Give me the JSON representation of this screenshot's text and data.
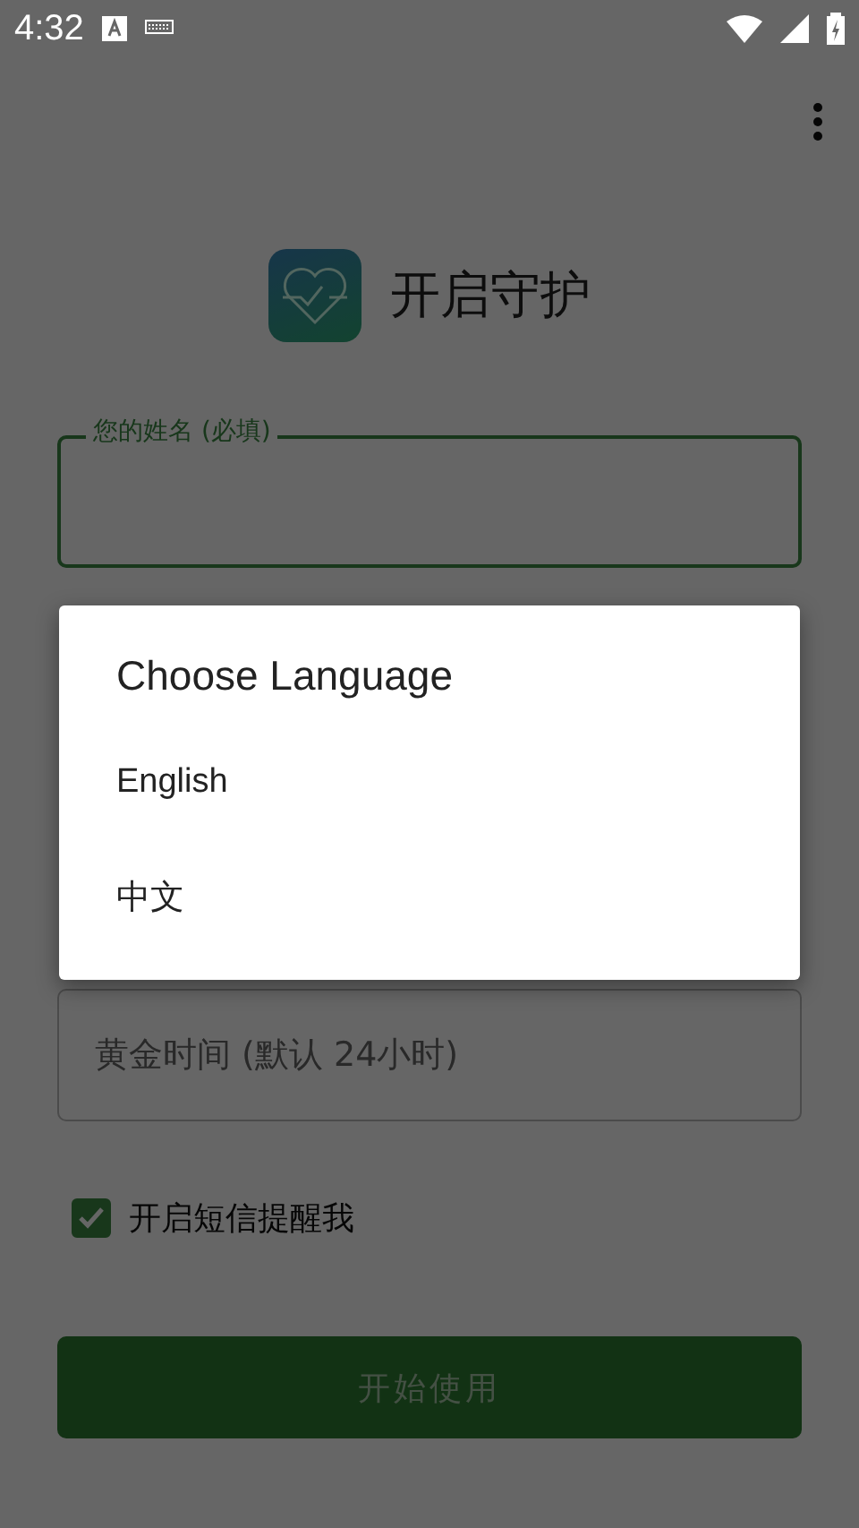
{
  "status_bar": {
    "time": "4:32"
  },
  "header": {
    "title": "开启守护"
  },
  "form": {
    "name_field": {
      "label": "您的姓名 (必填)",
      "focused": true
    },
    "golden_time_field": {
      "placeholder": "黄金时间 (默认 24小时)"
    },
    "sms_checkbox": {
      "label": "开启短信提醒我",
      "checked": true
    },
    "start_button": {
      "label": "开始使用"
    }
  },
  "dialog": {
    "title": "Choose Language",
    "options": [
      {
        "label": "English"
      },
      {
        "label": "中文"
      }
    ]
  }
}
